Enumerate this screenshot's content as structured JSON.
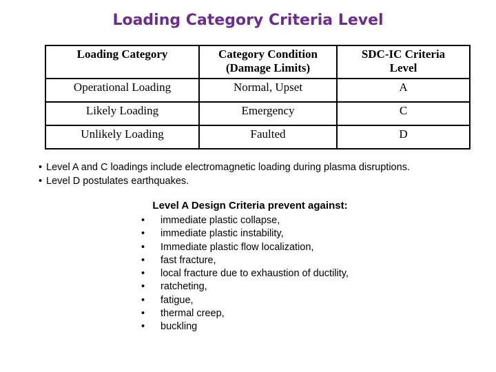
{
  "slide": {
    "title": "Loading Category Criteria Level",
    "title_color": "#6B2D8E",
    "background_color": "#FFFFFF"
  },
  "table": {
    "headers": [
      "Loading Category",
      "Category Condition (Damage Limits)",
      "SDC-IC Criteria Level"
    ],
    "header_lines": {
      "col1_line1": "Loading Category",
      "col1_line2": "",
      "col2_line1": "Category Condition",
      "col2_line2": "(Damage Limits)",
      "col3_line1": "SDC-IC Criteria",
      "col3_line2": "Level"
    },
    "rows": [
      {
        "loading_category": "Operational Loading",
        "category_condition": "Normal, Upset",
        "sdc_ic_criteria_level": "A"
      },
      {
        "loading_category": "Likely Loading",
        "category_condition": "Emergency",
        "sdc_ic_criteria_level": "C"
      },
      {
        "loading_category": "Unlikely Loading",
        "category_condition": "Faulted",
        "sdc_ic_criteria_level": "D"
      }
    ]
  },
  "notes": {
    "bullet_glyph": "•",
    "items": [
      "Level A and C loadings include electromagnetic loading during plasma disruptions.",
      "Level D postulates earthquakes."
    ]
  },
  "criteria_section": {
    "heading": "Level A Design Criteria prevent against:",
    "bullet_glyph": "•",
    "items": [
      "immediate plastic collapse,",
      "immediate plastic instability,",
      "Immediate plastic flow localization,",
      "fast fracture,",
      "local fracture due to exhaustion of ductility,",
      "ratcheting,",
      "fatigue,",
      "thermal creep,",
      "buckling"
    ]
  }
}
